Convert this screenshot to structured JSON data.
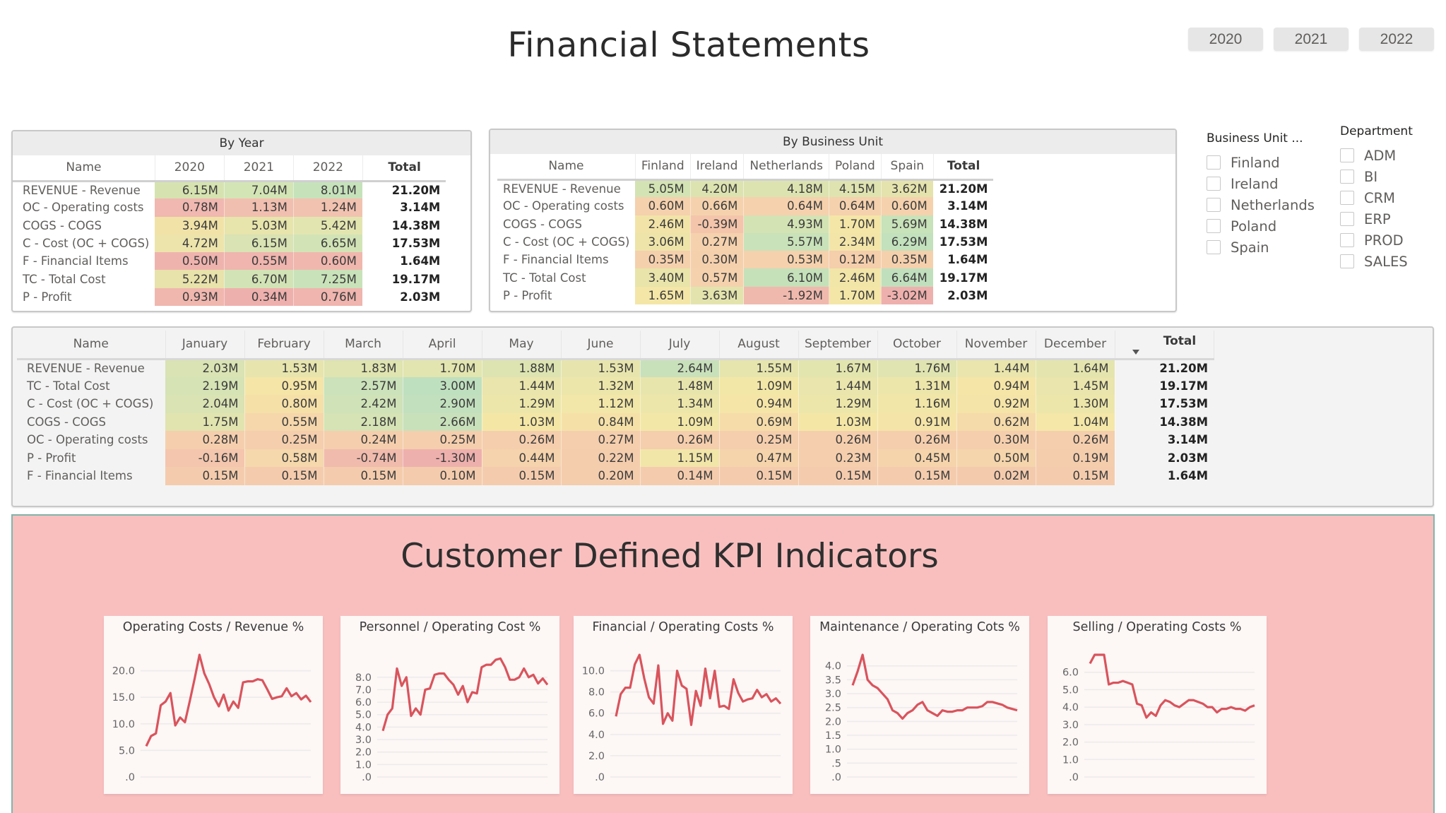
{
  "page": {
    "title": "Financial Statements"
  },
  "year_filter": {
    "buttons": [
      "2020",
      "2021",
      "2022"
    ]
  },
  "by_year": {
    "title": "By Year",
    "columns": [
      "Name",
      "2020",
      "2021",
      "2022",
      "Total"
    ],
    "rows": [
      {
        "name": "REVENUE - Revenue",
        "values": [
          "6.15M",
          "7.04M",
          "8.01M"
        ],
        "colors": [
          "#d6e3b0",
          "#d3e5b5",
          "#c6e2bb"
        ],
        "total": "21.20M"
      },
      {
        "name": "OC - Operating costs",
        "values": [
          "0.78M",
          "1.13M",
          "1.24M"
        ],
        "colors": [
          "#f0b8b0",
          "#f1bfb0",
          "#f2c2b0"
        ],
        "total": "3.14M"
      },
      {
        "name": "COGS - COGS",
        "values": [
          "3.94M",
          "5.03M",
          "5.42M"
        ],
        "colors": [
          "#f1e2a8",
          "#e7e4ac",
          "#e3e5b0"
        ],
        "total": "14.38M"
      },
      {
        "name": "C - Cost (OC + COGS)",
        "values": [
          "4.72M",
          "6.15M",
          "6.65M"
        ],
        "colors": [
          "#ede4ac",
          "#d9e3b3",
          "#d2e4b6"
        ],
        "total": "17.53M"
      },
      {
        "name": "F - Financial Items",
        "values": [
          "0.50M",
          "0.55M",
          "0.60M"
        ],
        "colors": [
          "#efb3ae",
          "#efb5ae",
          "#f0b7ae"
        ],
        "total": "1.64M"
      },
      {
        "name": "TC - Total Cost",
        "values": [
          "5.22M",
          "6.70M",
          "7.25M"
        ],
        "colors": [
          "#e8e2ab",
          "#d2e3b5",
          "#c9e2b9"
        ],
        "total": "19.17M"
      },
      {
        "name": "P - Profit",
        "values": [
          "0.93M",
          "0.34M",
          "0.76M"
        ],
        "colors": [
          "#f0b7ae",
          "#eeb0ad",
          "#efb5ae"
        ],
        "total": "2.03M"
      }
    ]
  },
  "by_business_unit": {
    "title": "By Business Unit",
    "columns": [
      "Name",
      "Finland",
      "Ireland",
      "Netherlands",
      "Poland",
      "Spain",
      "Total"
    ],
    "rows": [
      {
        "name": "REVENUE - Revenue",
        "values": [
          "5.05M",
          "4.20M",
          "4.18M",
          "4.15M",
          "3.62M"
        ],
        "colors": [
          "#d3e3b3",
          "#dde3b0",
          "#dde3b0",
          "#dee3b0",
          "#e5e3ad"
        ],
        "total": "21.20M"
      },
      {
        "name": "OC - Operating costs",
        "values": [
          "0.60M",
          "0.66M",
          "0.64M",
          "0.64M",
          "0.60M"
        ],
        "colors": [
          "#f5d1ad",
          "#f5d2ad",
          "#f5d1ad",
          "#f5d1ad",
          "#f5d1ad"
        ],
        "total": "3.14M"
      },
      {
        "name": "COGS - COGS",
        "values": [
          "2.46M",
          "-0.39M",
          "4.93M",
          "1.70M",
          "5.69M"
        ],
        "colors": [
          "#f2e4a8",
          "#f4c5ab",
          "#d3e3b4",
          "#f4e6a7",
          "#c8e2b9"
        ],
        "total": "14.38M"
      },
      {
        "name": "C - Cost (OC + COGS)",
        "values": [
          "3.06M",
          "0.27M",
          "5.57M",
          "2.34M",
          "6.29M"
        ],
        "colors": [
          "#eee4a9",
          "#f5d1ad",
          "#c9e2b9",
          "#f3e5a8",
          "#c2e1bc"
        ],
        "total": "17.53M"
      },
      {
        "name": "F - Financial Items",
        "values": [
          "0.35M",
          "0.30M",
          "0.53M",
          "0.12M",
          "0.35M"
        ],
        "colors": [
          "#f5d0ad",
          "#f5d0ad",
          "#f5d1ad",
          "#f5ceac",
          "#f5d0ad"
        ],
        "total": "1.64M"
      },
      {
        "name": "TC - Total Cost",
        "values": [
          "3.40M",
          "0.57M",
          "6.10M",
          "2.46M",
          "6.64M"
        ],
        "colors": [
          "#e9e4aa",
          "#f5d2ad",
          "#c5e1ba",
          "#f2e5a8",
          "#c0e0bd"
        ],
        "total": "19.17M"
      },
      {
        "name": "P - Profit",
        "values": [
          "1.65M",
          "3.63M",
          "-1.92M",
          "1.70M",
          "-3.02M"
        ],
        "colors": [
          "#f4e6a7",
          "#e3e3ad",
          "#f0b9ae",
          "#f4e6a7",
          "#eeb0ad"
        ],
        "total": "2.03M"
      }
    ]
  },
  "slicers": {
    "business_unit": {
      "title": "Business Unit ...",
      "options": [
        "Finland",
        "Ireland",
        "Netherlands",
        "Poland",
        "Spain"
      ],
      "checked": [
        false,
        false,
        false,
        false,
        false
      ]
    },
    "department": {
      "title": "Department",
      "options": [
        "ADM",
        "BI",
        "CRM",
        "ERP",
        "PROD",
        "SALES"
      ],
      "checked": [
        false,
        false,
        false,
        false,
        false,
        false
      ]
    }
  },
  "monthly": {
    "columns": [
      "Name",
      "January",
      "February",
      "March",
      "April",
      "May",
      "June",
      "July",
      "August",
      "September",
      "October",
      "November",
      "December",
      "Total"
    ],
    "sort_column": "Total",
    "rows": [
      {
        "name": "REVENUE - Revenue",
        "values": [
          "2.03M",
          "1.53M",
          "1.83M",
          "1.70M",
          "1.88M",
          "1.53M",
          "2.64M",
          "1.55M",
          "1.67M",
          "1.76M",
          "1.44M",
          "1.64M"
        ],
        "total": "21.20M"
      },
      {
        "name": "TC - Total Cost",
        "values": [
          "2.19M",
          "0.95M",
          "2.57M",
          "3.00M",
          "1.44M",
          "1.32M",
          "1.48M",
          "1.09M",
          "1.44M",
          "1.31M",
          "0.94M",
          "1.45M"
        ],
        "total": "19.17M"
      },
      {
        "name": "C - Cost (OC + COGS)",
        "values": [
          "2.04M",
          "0.80M",
          "2.42M",
          "2.90M",
          "1.29M",
          "1.12M",
          "1.34M",
          "0.94M",
          "1.29M",
          "1.16M",
          "0.92M",
          "1.30M"
        ],
        "total": "17.53M"
      },
      {
        "name": "COGS - COGS",
        "values": [
          "1.75M",
          "0.55M",
          "2.18M",
          "2.66M",
          "1.03M",
          "0.84M",
          "1.09M",
          "0.69M",
          "1.03M",
          "0.91M",
          "0.62M",
          "1.04M"
        ],
        "total": "14.38M"
      },
      {
        "name": "OC - Operating costs",
        "values": [
          "0.28M",
          "0.25M",
          "0.24M",
          "0.25M",
          "0.26M",
          "0.27M",
          "0.26M",
          "0.25M",
          "0.26M",
          "0.26M",
          "0.30M",
          "0.26M"
        ],
        "total": "3.14M"
      },
      {
        "name": "P - Profit",
        "values": [
          "-0.16M",
          "0.58M",
          "-0.74M",
          "-1.30M",
          "0.44M",
          "0.22M",
          "1.15M",
          "0.47M",
          "0.23M",
          "0.45M",
          "0.50M",
          "0.19M"
        ],
        "total": "2.03M"
      },
      {
        "name": "F - Financial Items",
        "values": [
          "0.15M",
          "0.15M",
          "0.15M",
          "0.10M",
          "0.15M",
          "0.20M",
          "0.14M",
          "0.15M",
          "0.15M",
          "0.15M",
          "0.02M",
          "0.15M"
        ],
        "total": "1.64M"
      }
    ],
    "color_scale": {
      "min": -1.3,
      "max": 3.0,
      "low": "#eeb0ad",
      "mid": "#f5e7a6",
      "high": "#bfe0bf"
    }
  },
  "kpi": {
    "title": "Customer Defined KPI Indicators",
    "line_color": "#d9545c",
    "section_color": "#f9bfbf"
  },
  "chart_data": [
    {
      "type": "line",
      "title": "Operating Costs / Revenue %",
      "xlabel": "",
      "ylabel": "",
      "ylim": [
        0,
        23
      ],
      "yticks": [
        0,
        5,
        10,
        15,
        20
      ],
      "ytick_labels": [
        ".0",
        "5.0",
        "10.0",
        "15.0",
        "20.0"
      ],
      "grid": true,
      "values": [
        5.8,
        7.7,
        8.2,
        13.5,
        14.2,
        15.8,
        9.7,
        11.2,
        10.3,
        14.3,
        18.5,
        23.0,
        19.5,
        17.5,
        15.0,
        13.3,
        15.5,
        12.5,
        14.2,
        13.0,
        17.8,
        18.0,
        18.0,
        18.4,
        18.2,
        16.5,
        14.7,
        15.0,
        15.2,
        16.7,
        15.2,
        15.8,
        14.6,
        15.3,
        14.1
      ]
    },
    {
      "type": "line",
      "title": "Personnel / Operating Cost %",
      "xlabel": "",
      "ylabel": "",
      "ylim": [
        0,
        9.8
      ],
      "yticks": [
        0,
        1,
        2,
        3,
        4,
        5,
        6,
        7,
        8
      ],
      "ytick_labels": [
        ".0",
        "1.0",
        "2.0",
        "3.0",
        "4.0",
        "5.0",
        "6.0",
        "7.0",
        "8.0"
      ],
      "grid": true,
      "values": [
        3.7,
        5.0,
        5.5,
        8.7,
        7.3,
        8.0,
        4.9,
        5.5,
        5.0,
        7.0,
        7.1,
        8.2,
        8.3,
        8.3,
        7.8,
        7.4,
        6.6,
        7.3,
        6.0,
        6.8,
        6.7,
        8.8,
        9.0,
        9.0,
        9.4,
        9.5,
        8.8,
        7.8,
        7.8,
        8.0,
        8.7,
        8.0,
        8.2,
        7.5,
        7.9,
        7.4
      ]
    },
    {
      "type": "line",
      "title": "Financial / Operating Costs %",
      "xlabel": "",
      "ylabel": "",
      "ylim": [
        0,
        11.5
      ],
      "yticks": [
        0,
        2,
        4,
        6,
        8,
        10
      ],
      "ytick_labels": [
        ".0",
        "2.0",
        "4.0",
        "6.0",
        "8.0",
        "10.0"
      ],
      "grid": true,
      "values": [
        5.7,
        7.8,
        8.4,
        8.4,
        10.6,
        11.5,
        9.3,
        7.5,
        6.9,
        10.5,
        5.0,
        6.0,
        5.3,
        10.0,
        8.6,
        8.3,
        4.9,
        8.1,
        6.7,
        10.2,
        7.4,
        10.0,
        6.6,
        6.7,
        6.4,
        9.2,
        7.9,
        7.1,
        7.3,
        7.4,
        8.2,
        7.5,
        7.8,
        7.1,
        7.4,
        6.9
      ]
    },
    {
      "type": "line",
      "title": "Maintenance / Operating Cots %",
      "xlabel": "",
      "ylabel": "",
      "ylim": [
        0,
        4.4
      ],
      "yticks": [
        0,
        0.5,
        1.0,
        1.5,
        2.0,
        2.5,
        3.0,
        3.5,
        4.0
      ],
      "ytick_labels": [
        ".0",
        ".5",
        "1.0",
        "1.5",
        "2.0",
        "2.5",
        "3.0",
        "3.5",
        "4.0"
      ],
      "grid": true,
      "values": [
        3.3,
        3.8,
        4.4,
        3.5,
        3.3,
        3.2,
        3.0,
        2.8,
        2.4,
        2.3,
        2.1,
        2.3,
        2.4,
        2.6,
        2.7,
        2.4,
        2.3,
        2.2,
        2.4,
        2.35,
        2.35,
        2.4,
        2.4,
        2.5,
        2.5,
        2.5,
        2.55,
        2.7,
        2.7,
        2.65,
        2.6,
        2.5,
        2.45,
        2.4
      ]
    },
    {
      "type": "line",
      "title": "Selling / Operating Costs %",
      "xlabel": "",
      "ylabel": "",
      "ylim": [
        0,
        7.0
      ],
      "yticks": [
        0,
        1,
        2,
        3,
        4,
        5,
        6
      ],
      "ytick_labels": [
        ".0",
        "1.0",
        "2.0",
        "3.0",
        "4.0",
        "5.0",
        "6.0"
      ],
      "grid": true,
      "values": [
        6.5,
        7.0,
        7.0,
        7.0,
        5.3,
        5.4,
        5.4,
        5.5,
        5.4,
        5.3,
        4.2,
        4.1,
        3.4,
        3.7,
        3.5,
        4.1,
        4.4,
        4.3,
        4.1,
        4.0,
        4.2,
        4.4,
        4.4,
        4.3,
        4.2,
        4.0,
        4.0,
        3.7,
        3.9,
        3.9,
        4.0,
        3.9,
        3.9,
        3.8,
        4.0,
        4.1
      ]
    }
  ]
}
